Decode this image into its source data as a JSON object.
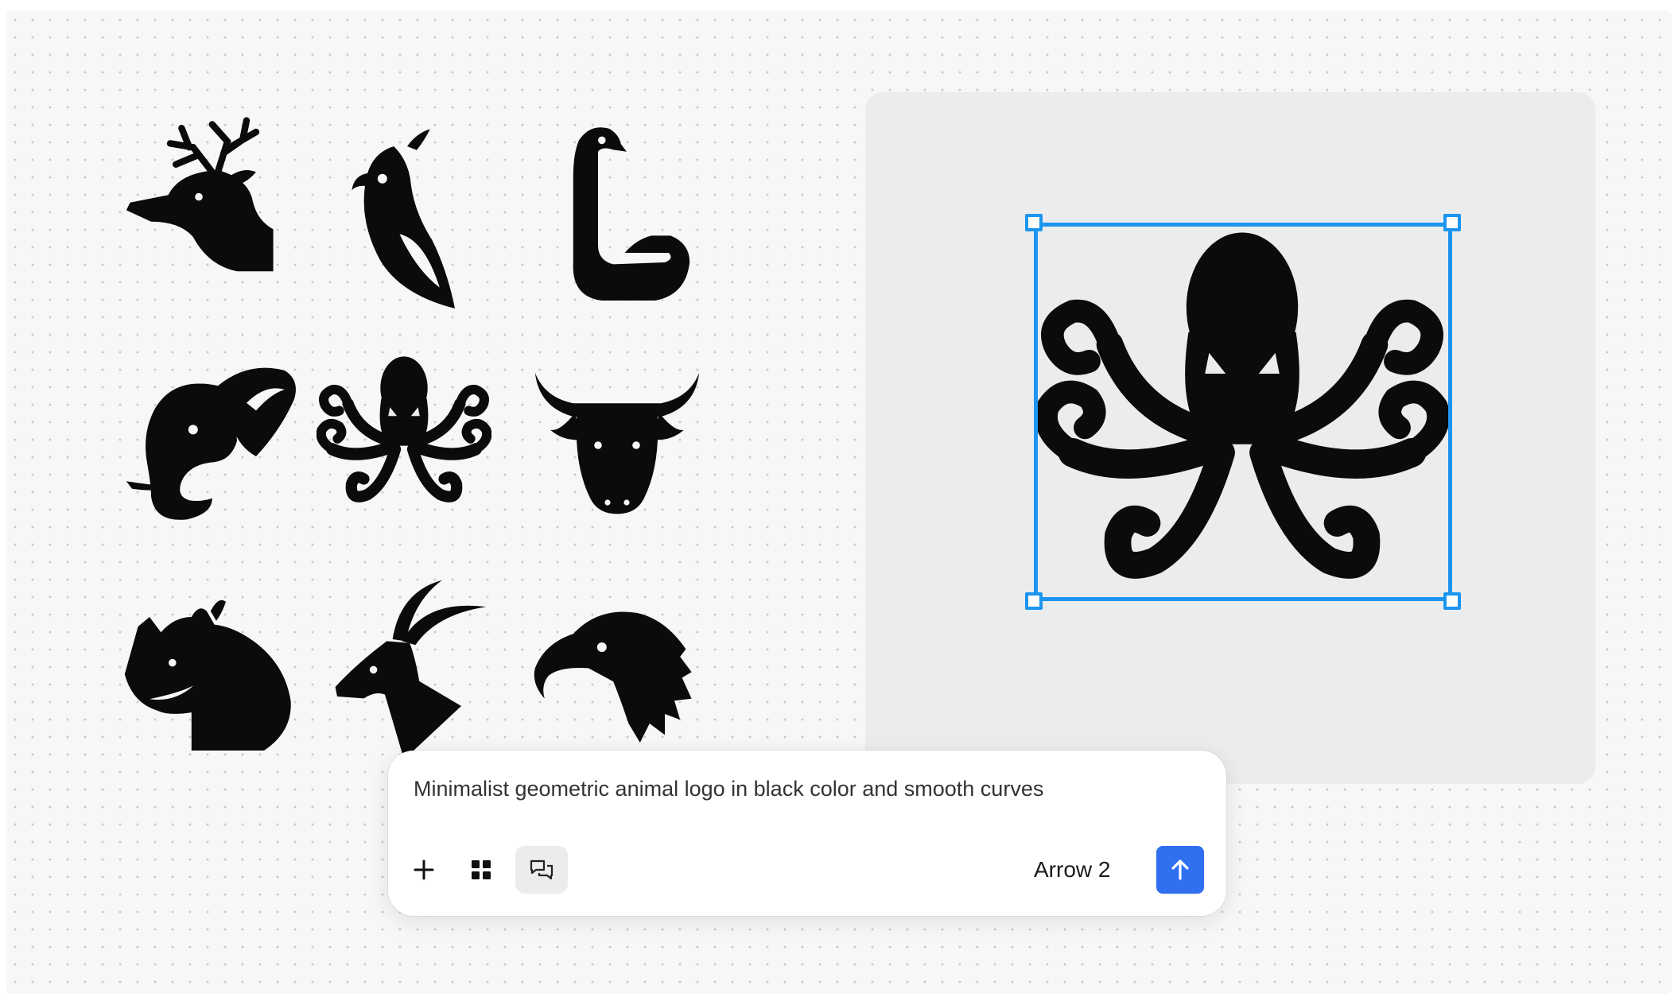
{
  "canvas": {
    "logos": [
      {
        "name": "deer",
        "icon": "deer-logo-icon"
      },
      {
        "name": "parrot",
        "icon": "parrot-logo-icon"
      },
      {
        "name": "swan",
        "icon": "swan-logo-icon"
      },
      {
        "name": "elephant",
        "icon": "elephant-logo-icon"
      },
      {
        "name": "octopus",
        "icon": "octopus-logo-icon"
      },
      {
        "name": "bull",
        "icon": "bull-logo-icon"
      },
      {
        "name": "rhino",
        "icon": "rhino-logo-icon"
      },
      {
        "name": "antelope",
        "icon": "antelope-logo-icon"
      },
      {
        "name": "eagle",
        "icon": "eagle-logo-icon"
      }
    ],
    "selected_logo": "octopus",
    "selection_color": "#1b95ef"
  },
  "prompt": {
    "text": "Minimalist geometric animal logo in black color and smooth curves",
    "model_label": "Arrow 2",
    "add_icon": "plus-icon",
    "grid_icon": "grid-icon",
    "chat_icon": "chat-icon",
    "send_icon": "arrow-up-icon",
    "send_color": "#2f6ff0"
  }
}
